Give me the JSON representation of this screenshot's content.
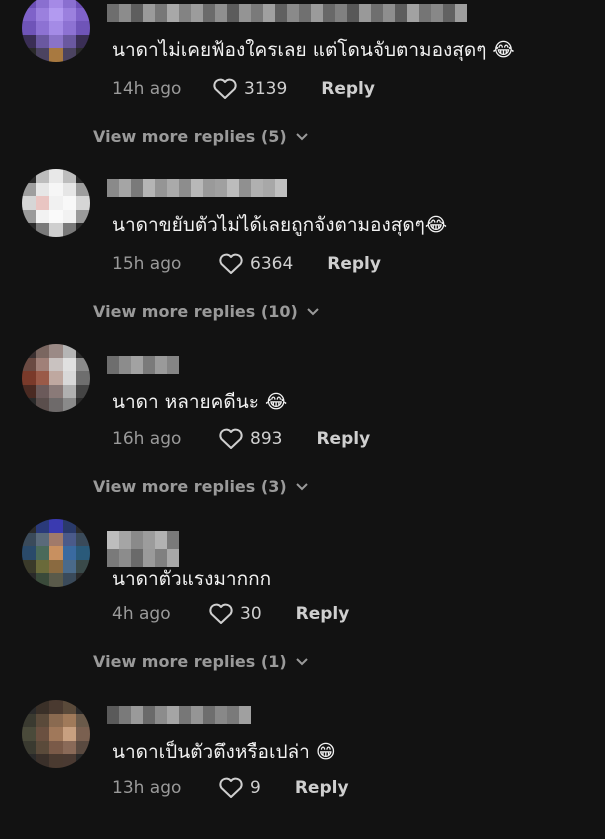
{
  "comments": [
    {
      "text": "นาดาไม่เคยฟ้องใครเลย แต่โดนจับตามองสุดๆ 😂",
      "time": "14h ago",
      "likes": "3139",
      "reply": "Reply",
      "more": "View more replies (5)"
    },
    {
      "text": "นาดาขยับตัวไม่ได้เลยถูกจังตามองสุดๆ😂",
      "time": "15h ago",
      "likes": "6364",
      "reply": "Reply",
      "more": "View more replies (10)"
    },
    {
      "text": "นาดา หลายคดีนะ 😂",
      "time": "16h ago",
      "likes": "893",
      "reply": "Reply",
      "more": "View more replies (3)"
    },
    {
      "text": "นาดาตัวแรงมากกก",
      "time": "4h ago",
      "likes": "30",
      "reply": "Reply",
      "more": "View more replies (1)"
    },
    {
      "text": "นาดาเป็นตัวตึงหรือเปล่า 😁",
      "time": "13h ago",
      "likes": "9",
      "reply": "Reply"
    }
  ]
}
